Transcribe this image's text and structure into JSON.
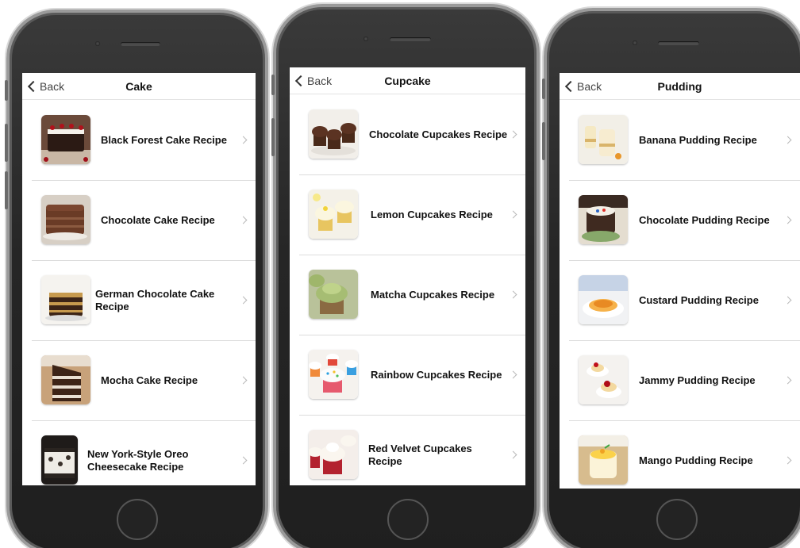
{
  "phones": [
    {
      "back_label": "Back",
      "title": "Cake",
      "items": [
        {
          "label": "Black Forest Cake Recipe"
        },
        {
          "label": "Chocolate Cake Recipe"
        },
        {
          "label": "German Chocolate Cake Recipe"
        },
        {
          "label": "Mocha Cake Recipe"
        },
        {
          "label": "New York-Style Oreo Cheesecake Recipe"
        }
      ]
    },
    {
      "back_label": "Back",
      "title": "Cupcake",
      "items": [
        {
          "label": "Chocolate Cupcakes Recipe"
        },
        {
          "label": "Lemon Cupcakes Recipe"
        },
        {
          "label": "Matcha Cupcakes Recipe"
        },
        {
          "label": "Rainbow Cupcakes Recipe"
        },
        {
          "label": "Red Velvet Cupcakes Recipe"
        }
      ]
    },
    {
      "back_label": "Back",
      "title": "Pudding",
      "items": [
        {
          "label": "Banana Pudding Recipe"
        },
        {
          "label": "Chocolate Pudding Recipe"
        },
        {
          "label": "Custard Pudding Recipe"
        },
        {
          "label": "Jammy Pudding Recipe"
        },
        {
          "label": "Mango Pudding Recipe"
        }
      ]
    }
  ]
}
